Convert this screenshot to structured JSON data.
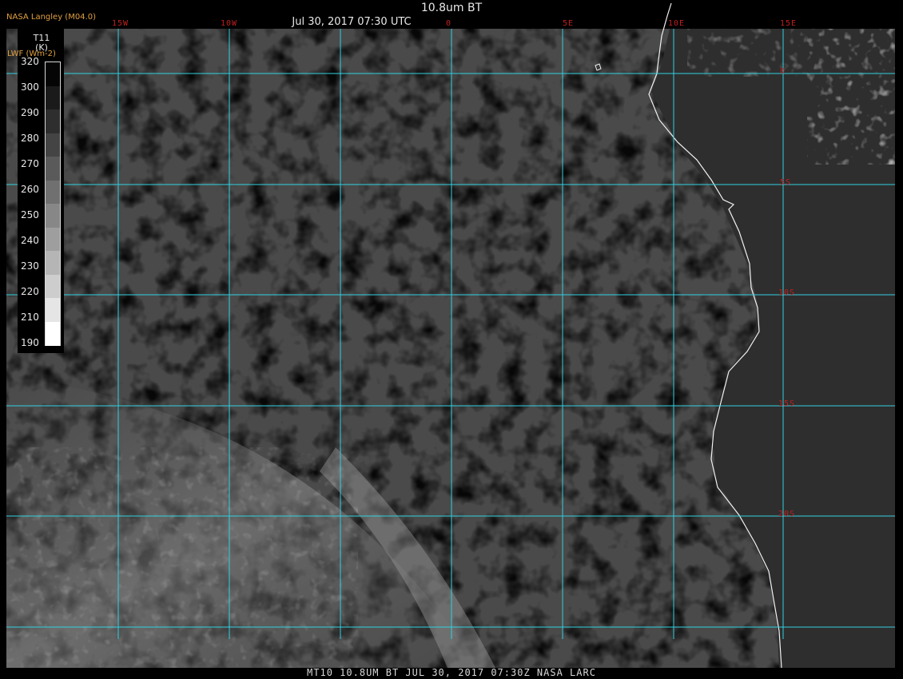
{
  "header": {
    "title": "10.8um BT",
    "datetime": "Jul 30, 2017 07:30 UTC",
    "credit": "NASA Langley (M04.0)"
  },
  "legend": {
    "title_line1": "T11",
    "title_line2": "(K)",
    "subtitle": "LWF (Wm-2)",
    "labels": [
      "320",
      "300",
      "290",
      "280",
      "270",
      "260",
      "250",
      "240",
      "230",
      "220",
      "210",
      "190"
    ],
    "colors": [
      "#050505",
      "#1a1a1a",
      "#2e2e2e",
      "#444444",
      "#5a5a5a",
      "#707070",
      "#878787",
      "#9e9e9e",
      "#b5b5b5",
      "#cdcdcd",
      "#e5e5e5",
      "#ffffff"
    ]
  },
  "grid": {
    "color": "#30d0e0",
    "longitudes": [
      "15W",
      "10W",
      "0",
      "5E",
      "10E",
      "15E"
    ],
    "latitudes": [
      "0",
      "5S",
      "10S",
      "15S",
      "20S"
    ],
    "label_color": "#c02020"
  },
  "footer": {
    "text": "MT10  10.8UM BT   JUL 30, 2017 07:30Z   NASA LARC"
  }
}
